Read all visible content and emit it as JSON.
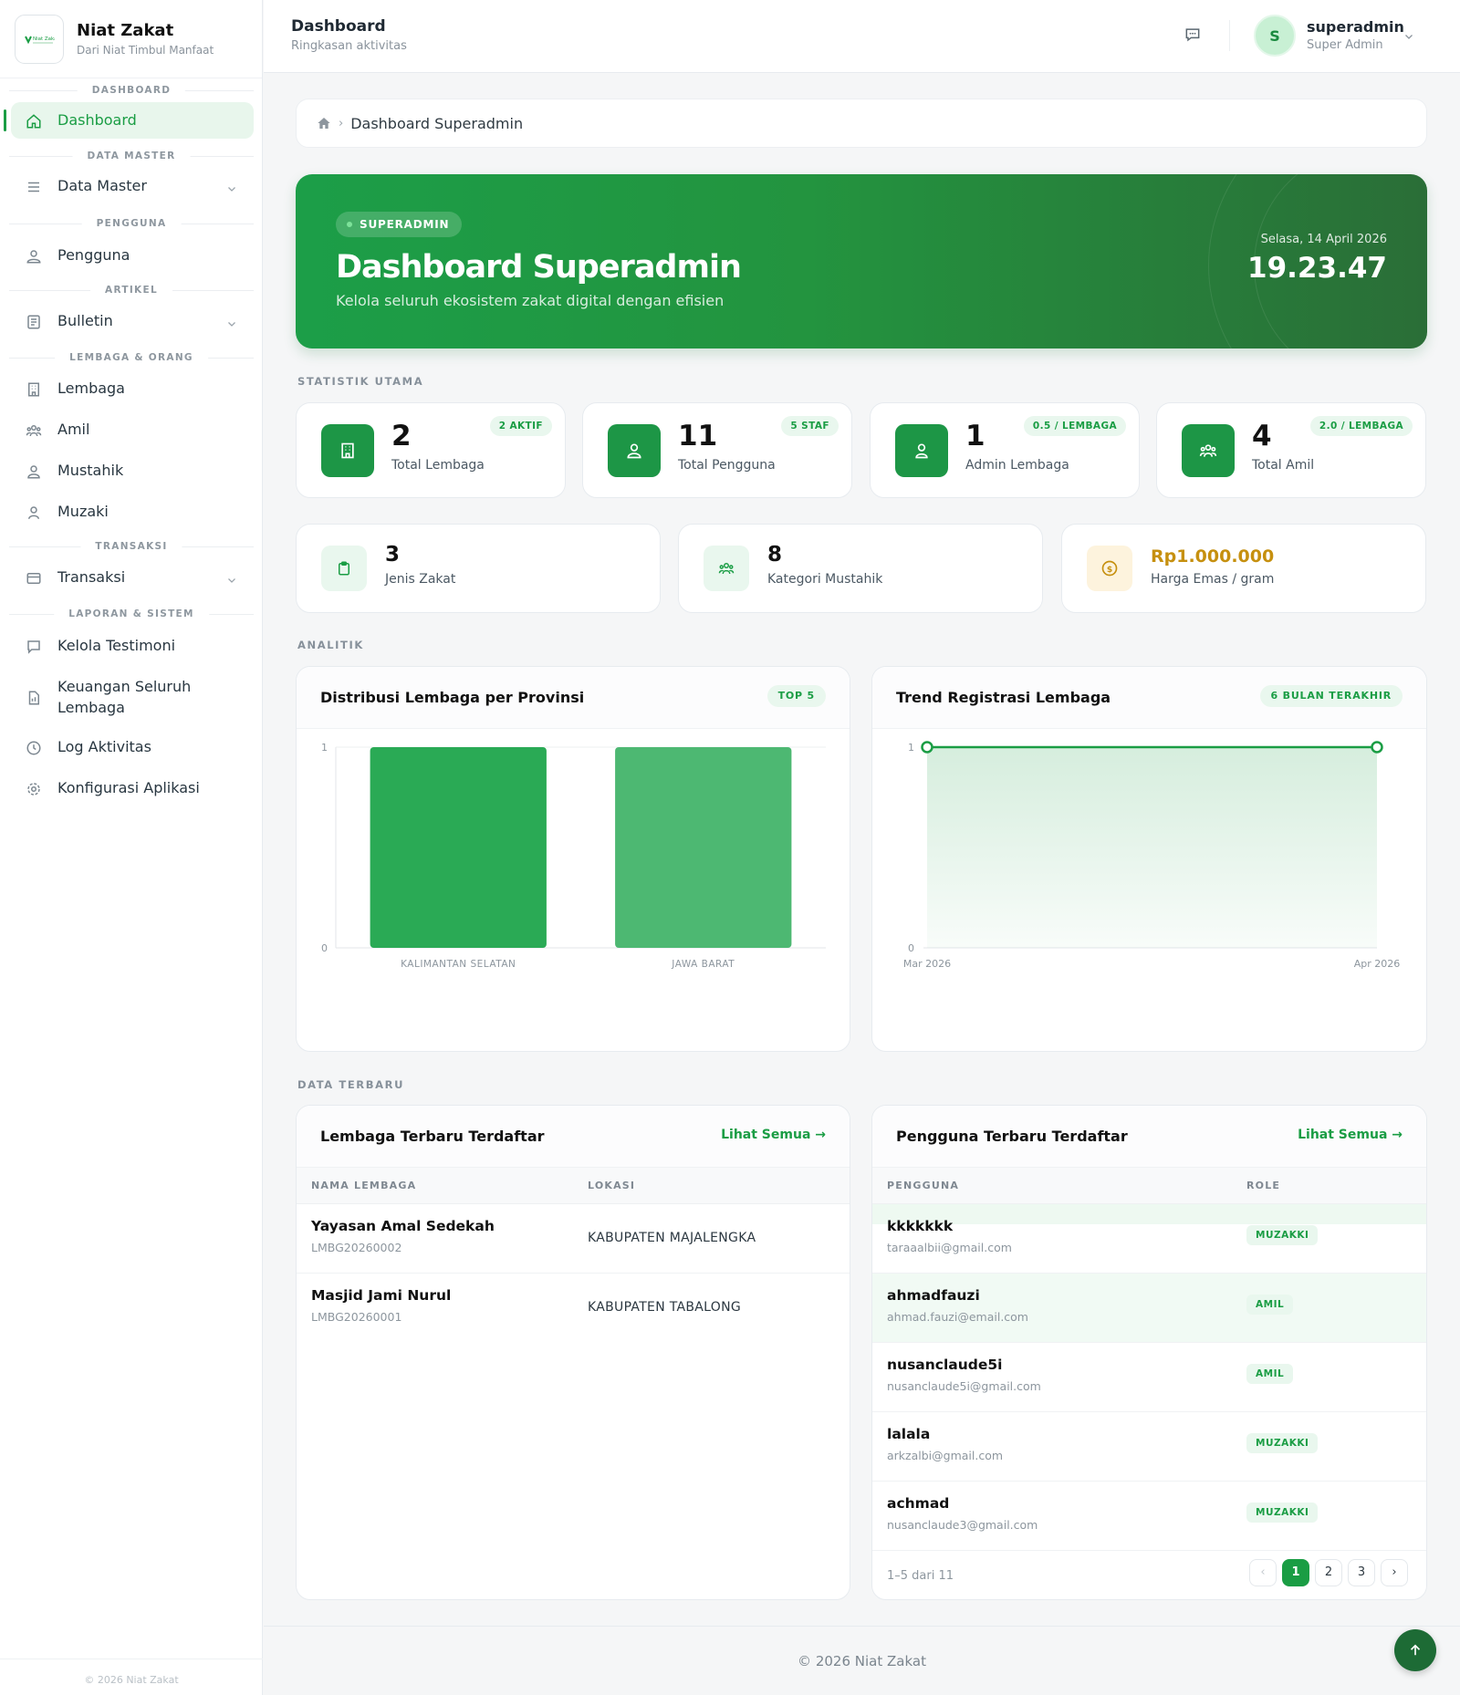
{
  "brand": {
    "name": "Niat Zakat",
    "tagline": "Dari Niat Timbul Manfaat",
    "logo_text": "Niat Zakat"
  },
  "sidebar": {
    "sections": {
      "dashboard": "DASHBOARD",
      "data_master": "DATA MASTER",
      "pengguna": "PENGGUNA",
      "artikel": "ARTIKEL",
      "lembaga_orang": "LEMBAGA & ORANG",
      "transaksi": "TRANSAKSI",
      "laporan": "LAPORAN & SISTEM"
    },
    "items": {
      "dashboard": "Dashboard",
      "data_master": "Data Master",
      "pengguna": "Pengguna",
      "bulletin": "Bulletin",
      "lembaga": "Lembaga",
      "amil": "Amil",
      "mustahik": "Mustahik",
      "muzaki": "Muzaki",
      "transaksi": "Transaksi",
      "testimoni": "Kelola Testimoni",
      "keuangan_1": "Keuangan Seluruh",
      "keuangan_2": "Lembaga",
      "log": "Log Aktivitas",
      "konfigurasi": "Konfigurasi Aplikasi"
    },
    "footer": "© 2026 Niat Zakat"
  },
  "header": {
    "title": "Dashboard",
    "subtitle": "Ringkasan aktivitas",
    "user_name": "superadmin",
    "user_role": "Super Admin",
    "avatar_initial": "S"
  },
  "breadcrumb": {
    "current": "Dashboard Superadmin"
  },
  "hero": {
    "badge": "SUPERADMIN",
    "title": "Dashboard Superadmin",
    "subtitle": "Kelola seluruh ekosistem zakat digital dengan efisien",
    "date": "Selasa, 14 April 2026",
    "time": "19.23.47"
  },
  "sections": {
    "statistik": "STATISTIK UTAMA",
    "analitik": "ANALITIK",
    "data_terbaru": "DATA TERBARU"
  },
  "stats": [
    {
      "value": "2",
      "label": "Total Lembaga",
      "badge": "2 AKTIF",
      "icon": "building-icon"
    },
    {
      "value": "11",
      "label": "Total Pengguna",
      "badge": "5 STAF",
      "icon": "users-icon"
    },
    {
      "value": "1",
      "label": "Admin Lembaga",
      "badge": "0.5 / LEMBAGA",
      "icon": "user-icon"
    },
    {
      "value": "4",
      "label": "Total Amil",
      "badge": "2.0 / LEMBAGA",
      "icon": "group-icon"
    }
  ],
  "mini_stats": [
    {
      "value": "3",
      "label": "Jenis Zakat",
      "icon": "clipboard-icon"
    },
    {
      "value": "8",
      "label": "Kategori Mustahik",
      "icon": "group-icon"
    },
    {
      "value": "Rp1.000.000",
      "label": "Harga Emas / gram",
      "icon": "coin-icon"
    }
  ],
  "charts": {
    "bar_title": "Distribusi Lembaga per Provinsi",
    "bar_badge": "TOP 5",
    "line_title": "Trend Registrasi Lembaga",
    "line_badge": "6 BULAN TERAKHIR"
  },
  "chart_data": [
    {
      "type": "bar",
      "categories": [
        "KALIMANTAN SELATAN",
        "JAWA BARAT"
      ],
      "values": [
        1,
        1
      ],
      "ylim": [
        0,
        1
      ],
      "yticks": [
        "0",
        "1"
      ],
      "colors": [
        "#2aaa55",
        "#4db872"
      ]
    },
    {
      "type": "area",
      "x": [
        "Mar 2026",
        "Apr 2026"
      ],
      "values": [
        1,
        1
      ],
      "ylim": [
        0,
        1
      ],
      "yticks": [
        "0",
        "1"
      ],
      "color": "#1a9d44"
    }
  ],
  "tables": {
    "lembaga": {
      "title": "Lembaga Terbaru Terdaftar",
      "link": "Lihat Semua →",
      "columns": [
        "NAMA LEMBAGA",
        "LOKASI"
      ],
      "rows": [
        {
          "name": "Yayasan Amal Sedekah",
          "code": "LMBG20260002",
          "location": "KABUPATEN MAJALENGKA"
        },
        {
          "name": "Masjid Jami Nurul",
          "code": "LMBG20260001",
          "location": "KABUPATEN TABALONG"
        }
      ]
    },
    "pengguna": {
      "title": "Pengguna Terbaru Terdaftar",
      "link": "Lihat Semua →",
      "columns": [
        "PENGGUNA",
        "ROLE"
      ],
      "rows": [
        {
          "name": "kkkkkkk",
          "email": "taraaalbii@gmail.com",
          "role": "MUZAKKI"
        },
        {
          "name": "ahmadfauzi",
          "email": "ahmad.fauzi@email.com",
          "role": "AMIL"
        },
        {
          "name": "nusanclaude5i",
          "email": "nusanclaude5i@gmail.com",
          "role": "AMIL"
        },
        {
          "name": "lalala",
          "email": "arkzalbi@gmail.com",
          "role": "MUZAKKI"
        },
        {
          "name": "achmad",
          "email": "nusanclaude3@gmail.com",
          "role": "MUZAKKI"
        }
      ],
      "pagination": {
        "info": "1–5 dari 11",
        "prev": "‹",
        "pages": [
          "1",
          "2",
          "3"
        ],
        "next": "›",
        "current": "1"
      }
    }
  },
  "footer": "© 2026 Niat Zakat",
  "colors": {
    "primary": "#1a9d44",
    "primary_dark": "#1d6b35",
    "gold": "#c6900f"
  }
}
